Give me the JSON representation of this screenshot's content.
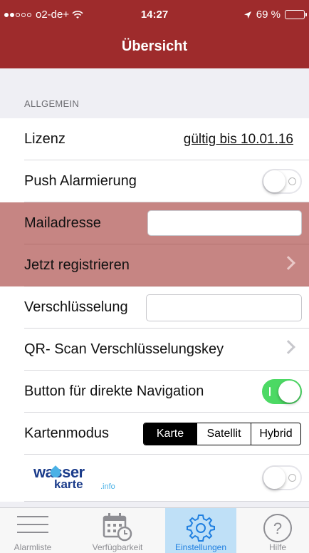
{
  "status": {
    "carrier": "o2-de+",
    "time": "14:27",
    "battery": "69 %",
    "battery_level": 0.69
  },
  "nav": {
    "title": "Übersicht"
  },
  "section": {
    "header": "ALLGEMEIN"
  },
  "rows": {
    "lizenz": {
      "label": "Lizenz",
      "value": "gültig bis 10.01.16"
    },
    "push": {
      "label": "Push Alarmierung",
      "on": false
    },
    "mail": {
      "label": "Mailadresse",
      "value": ""
    },
    "register": {
      "label": "Jetzt registrieren"
    },
    "encrypt": {
      "label": "Verschlüsselung",
      "value": ""
    },
    "qr": {
      "label": "QR- Scan Verschlüsselungskey"
    },
    "direct_nav": {
      "label": "Button für direkte Navigation",
      "on": true
    },
    "map_mode": {
      "label": "Kartenmodus",
      "options": [
        "Karte",
        "Satellit",
        "Hybrid"
      ],
      "selected": "Karte"
    },
    "wasser": {
      "logo_text_1": "wasser",
      "logo_text_2": "karte",
      "logo_text_3": ".info",
      "on": false
    }
  },
  "tabs": [
    {
      "label": "Alarmliste",
      "icon": "list-icon"
    },
    {
      "label": "Verfügbarkeit",
      "icon": "calendar-clock-icon"
    },
    {
      "label": "Einstellungen",
      "icon": "gear-icon",
      "active": true
    },
    {
      "label": "Hilfe",
      "icon": "help-icon"
    }
  ],
  "colors": {
    "brand": "#9e2b2c",
    "highlight_row": "#c68583",
    "toggle_on": "#4cd964",
    "tab_active": "#1f7fe0"
  }
}
